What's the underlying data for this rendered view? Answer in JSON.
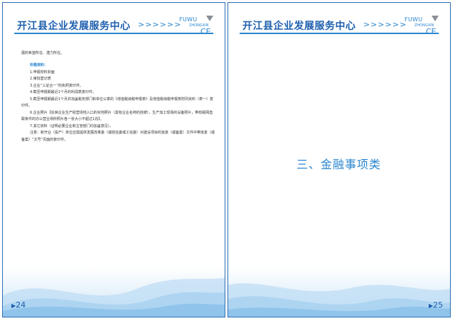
{
  "header": {
    "title": "开江县企业发展服务中心",
    "arrows": ">>>>>>",
    "logo_top": "FUWU",
    "logo_small": "ZHONGXIN",
    "logo_bottom": "CE"
  },
  "left_page": {
    "intro": "展的希望所在、潜力所在。",
    "docs_heading": "所需资料：",
    "items": [
      "1.申报材料封面",
      "2.审批登记表",
      "3.企业“三证合一”的执照复印件。",
      "4.截至申报期最近1个月的利润表复印件。",
      "5.截至申报期最近1个月并加盖税务部门和单位公章的《增值税纳税申报表》及增值税纳税申报表附列资料（表一）复印件。",
      "6.企业照片【反映企业生产经营场地入口的实地照片（需有企业名称的挂牌），生产加工现场的设备照片，带有联网直联条件的办公营业场所照片各一张大小不超过1兆】。",
      "7.其它资料（证明必要企业和主管部门均加盖意见）。",
      "注意：新开业（投产）单位还需提供发展改革委（或经信委或工信委）对建设项目的批复（或备案）文件中带批复（或备案）“文号”页面的复印件。"
    ],
    "page_number": "24"
  },
  "right_page": {
    "section_title": "三、金融事项类",
    "page_number": "25"
  },
  "colors": {
    "brand_blue": "#1d5fae",
    "accent_blue": "#2a86d0"
  }
}
